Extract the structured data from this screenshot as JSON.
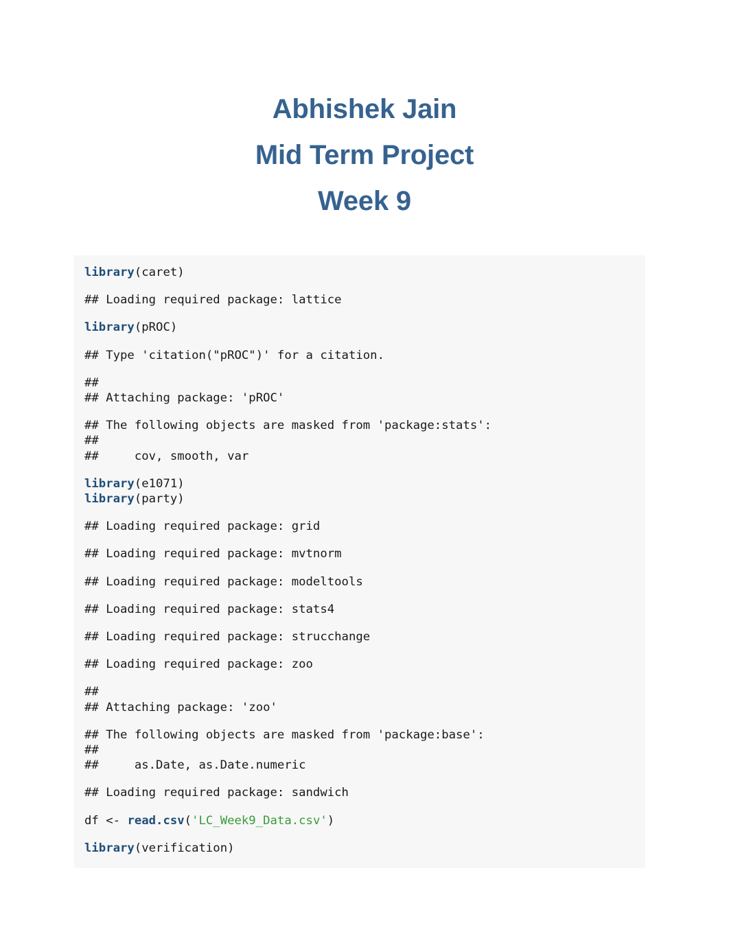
{
  "document": {
    "title_lines": [
      "Abhishek Jain",
      "Mid Term Project",
      "Week 9"
    ],
    "heading_color": "#36628f",
    "background_color": "#ffffff"
  },
  "code_panel": {
    "background_color": "#f7f7f7",
    "keyword_color": "#1f4e79",
    "string_color": "#3a9a3a",
    "text_color": "#1a1a1a",
    "blocks": [
      {
        "kind": "code",
        "segments": [
          {
            "type": "kw",
            "text": "library"
          },
          {
            "type": "plain",
            "text": "(caret)"
          }
        ]
      },
      {
        "kind": "output",
        "segments": [
          {
            "type": "plain",
            "text": "## Loading required package: lattice"
          }
        ]
      },
      {
        "kind": "code",
        "segments": [
          {
            "type": "kw",
            "text": "library"
          },
          {
            "type": "plain",
            "text": "(pROC)"
          }
        ]
      },
      {
        "kind": "output",
        "segments": [
          {
            "type": "plain",
            "text": "## Type 'citation(\"pROC\")' for a citation."
          }
        ]
      },
      {
        "kind": "output",
        "segments": [
          {
            "type": "plain",
            "text": "## \n## Attaching package: 'pROC'"
          }
        ]
      },
      {
        "kind": "output",
        "segments": [
          {
            "type": "plain",
            "text": "## The following objects are masked from 'package:stats':\n## \n##     cov, smooth, var"
          }
        ]
      },
      {
        "kind": "code",
        "segments": [
          {
            "type": "kw",
            "text": "library"
          },
          {
            "type": "plain",
            "text": "(e1071)\n"
          },
          {
            "type": "kw",
            "text": "library"
          },
          {
            "type": "plain",
            "text": "(party)"
          }
        ]
      },
      {
        "kind": "output",
        "segments": [
          {
            "type": "plain",
            "text": "## Loading required package: grid"
          }
        ]
      },
      {
        "kind": "output",
        "segments": [
          {
            "type": "plain",
            "text": "## Loading required package: mvtnorm"
          }
        ]
      },
      {
        "kind": "output",
        "segments": [
          {
            "type": "plain",
            "text": "## Loading required package: modeltools"
          }
        ]
      },
      {
        "kind": "output",
        "segments": [
          {
            "type": "plain",
            "text": "## Loading required package: stats4"
          }
        ]
      },
      {
        "kind": "output",
        "segments": [
          {
            "type": "plain",
            "text": "## Loading required package: strucchange"
          }
        ]
      },
      {
        "kind": "output",
        "segments": [
          {
            "type": "plain",
            "text": "## Loading required package: zoo"
          }
        ]
      },
      {
        "kind": "output",
        "segments": [
          {
            "type": "plain",
            "text": "## \n## Attaching package: 'zoo'"
          }
        ]
      },
      {
        "kind": "output",
        "segments": [
          {
            "type": "plain",
            "text": "## The following objects are masked from 'package:base':\n## \n##     as.Date, as.Date.numeric"
          }
        ]
      },
      {
        "kind": "output",
        "segments": [
          {
            "type": "plain",
            "text": "## Loading required package: sandwich"
          }
        ]
      },
      {
        "kind": "code",
        "segments": [
          {
            "type": "plain",
            "text": "df <- "
          },
          {
            "type": "kw",
            "text": "read.csv"
          },
          {
            "type": "plain",
            "text": "("
          },
          {
            "type": "str",
            "text": "'LC_Week9_Data.csv'"
          },
          {
            "type": "plain",
            "text": ")"
          }
        ]
      },
      {
        "kind": "code",
        "segments": [
          {
            "type": "kw",
            "text": "library"
          },
          {
            "type": "plain",
            "text": "(verification)"
          }
        ]
      }
    ]
  }
}
